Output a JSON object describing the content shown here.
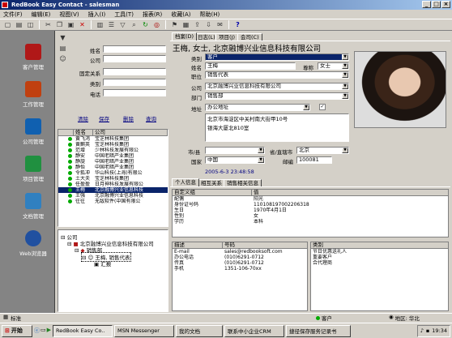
{
  "window": {
    "title": "RedBook Easy Contact - salesman",
    "btn_min": "_",
    "btn_max": "□",
    "btn_close": "×"
  },
  "menu": [
    "文件(F)",
    "编辑(E)",
    "视图(V)",
    "插入(I)",
    "工具(T)",
    "报表(R)",
    "收藏(A)",
    "帮助(H)"
  ],
  "toolbar": {
    "help": "?"
  },
  "nav": {
    "items": [
      {
        "label": "客户管理",
        "color": "#b01818"
      },
      {
        "label": "工作管理",
        "color": "#c04010"
      },
      {
        "label": "公司管理",
        "color": "#1060b0"
      },
      {
        "label": "项目管理",
        "color": "#209040"
      },
      {
        "label": "文档管理",
        "color": "#3080c0"
      },
      {
        "label": "Web浏览器",
        "color": "#2050a0"
      }
    ]
  },
  "search": {
    "fields": [
      {
        "label": "姓名",
        "value": ""
      },
      {
        "label": "公司",
        "value": ""
      },
      {
        "label": "固定关系",
        "value": ""
      },
      {
        "label": "类别",
        "value": ""
      },
      {
        "label": "电话",
        "value": ""
      }
    ],
    "links": [
      "清除",
      "保存",
      "删除",
      "查询"
    ]
  },
  "list": {
    "headers": [
      "姓名",
      "公司"
    ],
    "rows": [
      {
        "name": "黄飞鸿",
        "company": "宝芝林科技集团",
        "sel": false
      },
      {
        "name": "黄麒英",
        "company": "宝芝林科技集团",
        "sel": false
      },
      {
        "name": "范增",
        "company": "少林科技发展有限公",
        "sel": false
      },
      {
        "name": "静安",
        "company": "中国老暗产业集团",
        "sel": false
      },
      {
        "name": "静旋",
        "company": "中国老暗产业集团",
        "sel": false
      },
      {
        "name": "静怡",
        "company": "中国老暗产业集团",
        "sel": false
      },
      {
        "name": "令狐冲",
        "company": "华山科技(上海)有限公",
        "sel": false
      },
      {
        "name": "土大夫",
        "company": "宝芝林科技集团",
        "sel": false
      },
      {
        "name": "任盈盈",
        "company": "日月神科技发展有限公",
        "sel": false
      },
      {
        "name": "王梅",
        "company": "北京融博兴业信息科技",
        "sel": true
      },
      {
        "name": "王强",
        "company": "北京融博兴业信息科技",
        "sel": false
      },
      {
        "name": "往往",
        "company": "无敌软件(中国有限公",
        "sel": false
      }
    ]
  },
  "tree": {
    "root": "公司",
    "company": "北京融博兴业信息科技有限公司",
    "dept": "销售部",
    "person": "王梅, 销售代表",
    "report": "汇报"
  },
  "tabs": [
    "档案(D)",
    "日志(L)",
    "项目(J)",
    "会司(C)"
  ],
  "header": {
    "title": "王梅, 女士, 北京融博兴业信息科技有限公司"
  },
  "form": {
    "type_label": "类别",
    "type_value": "客户",
    "name_label": "姓名",
    "name_value": "王梅",
    "salutation_label": "尊称",
    "salutation_value": "女士",
    "position_label": "职位",
    "position_value": "销售代表",
    "company_label": "公司",
    "company_value": "北京融博兴业信息科技有限公司",
    "dept_label": "部门",
    "dept_value": "销售部",
    "address_label": "地址",
    "address_type": "办公地址",
    "address_line1": "北京市海淀区中关村南大街甲10号",
    "address_line2": "银海大厦北810室",
    "city_label": "市/县",
    "province_label": "省/直辖市",
    "province_value": "北京",
    "country_label": "国家",
    "country_value": "中国",
    "zip_label": "邮编",
    "zip_value": "100081",
    "date": "2005-6-3 23:48:58"
  },
  "subtabs": [
    "个人信息",
    "相互关系",
    "销售相关信息"
  ],
  "info_grid": {
    "headers": [
      "自定义组",
      "值"
    ],
    "rows": [
      [
        "配偶",
        "阳光"
      ],
      [
        "身份证号码",
        "110108197002206318"
      ],
      [
        "生日",
        "1970年4月1日"
      ],
      [
        "性别",
        "女"
      ],
      [
        "学历",
        "本科"
      ]
    ]
  },
  "contact_grid": {
    "headers": [
      "描述",
      "号码"
    ],
    "rows": [
      [
        "E-mail",
        "sales@redbooksoft.com"
      ],
      [
        "办公电话",
        "(010)6291-0712"
      ],
      [
        "传真",
        "(010)6291-0712"
      ],
      [
        "手机",
        "1351-106-70xx"
      ]
    ]
  },
  "category_grid": {
    "headers": [
      "类别"
    ],
    "rows": [
      [
        "节日优惠送礼人"
      ],
      [
        "重要客户"
      ],
      [
        "合代理商"
      ]
    ]
  },
  "status": {
    "left": "标准",
    "customer": "客户",
    "area": "地区: 华北"
  },
  "taskbar": {
    "start": "开始",
    "buttons": [
      {
        "label": "RedBook Easy Co..",
        "active": true
      },
      {
        "label": "MSN Messenger",
        "active": false
      },
      {
        "label": "我的文档",
        "active": false
      },
      {
        "label": "联系中小企业CRM",
        "active": false
      },
      {
        "label": "捷径保存服务记录书",
        "active": false
      }
    ],
    "clock": "19:34"
  }
}
